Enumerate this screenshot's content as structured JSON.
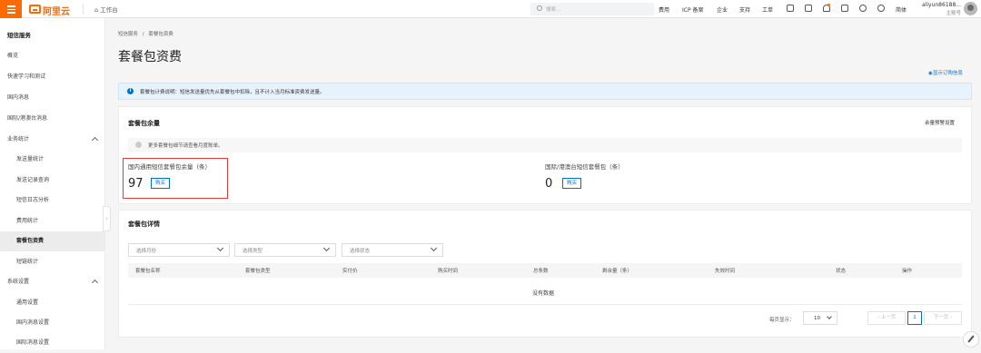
{
  "topbar": {
    "logo": "阿里云",
    "home": "工作台",
    "search_placeholder": "搜索...",
    "nav": [
      "费用",
      "ICP 备案",
      "企业",
      "支持",
      "工单"
    ],
    "lang": "简体",
    "user": "aliyun86188...",
    "user_sub": "主账号"
  },
  "sidebar": {
    "title": "短信服务",
    "items": [
      {
        "label": "概览",
        "level": 1
      },
      {
        "label": "快速学习和测试",
        "level": 1
      },
      {
        "label": "国内消息",
        "level": 1
      },
      {
        "label": "国际/港澳台消息",
        "level": 1
      },
      {
        "label": "业务统计",
        "level": 1,
        "expandable": true
      },
      {
        "label": "发送量统计",
        "level": 2
      },
      {
        "label": "发送记录查询",
        "level": 2
      },
      {
        "label": "短信日志分析",
        "level": 2
      },
      {
        "label": "费用统计",
        "level": 2
      },
      {
        "label": "套餐包资费",
        "level": 2,
        "active": true
      },
      {
        "label": "短链统计",
        "level": 2
      },
      {
        "label": "系统设置",
        "level": 1,
        "expandable": true
      },
      {
        "label": "通用设置",
        "level": 2
      },
      {
        "label": "国内消息设置",
        "level": 2
      },
      {
        "label": "国际消息设置",
        "level": 2
      }
    ]
  },
  "breadcrumb": {
    "parent": "短信服务",
    "separator": "/",
    "current": "套餐包资费"
  },
  "page_title": "套餐包资费",
  "show_order_info": "显示订购信息",
  "notice": "套餐包计费说明：短信发送量优先从套餐包中扣除，且不计入当月标准资费发送量。",
  "balance": {
    "title": "套餐包余量",
    "alarm_link": "余量预警设置",
    "tip": "更多套餐包细节请查看月度账单。",
    "domestic": {
      "label": "国内通用短信套餐包余量（条）",
      "value": "97",
      "buy": "购买"
    },
    "intl": {
      "label": "国际/港澳台短信套餐包（条）",
      "value": "0",
      "buy": "购买"
    }
  },
  "details": {
    "title": "套餐包详情",
    "filters": [
      "选择月份",
      "选择类型",
      "选择状态"
    ],
    "columns": [
      "套餐包名称",
      "套餐包类型",
      "实付价",
      "购买时间",
      "总条数",
      "剩余量（条）",
      "失效时间",
      "状态",
      "操作"
    ],
    "empty": "没有数据",
    "page_size_label": "每页显示：",
    "page_size": "10",
    "prev": "上一页",
    "page": "1",
    "next": "下一页"
  }
}
